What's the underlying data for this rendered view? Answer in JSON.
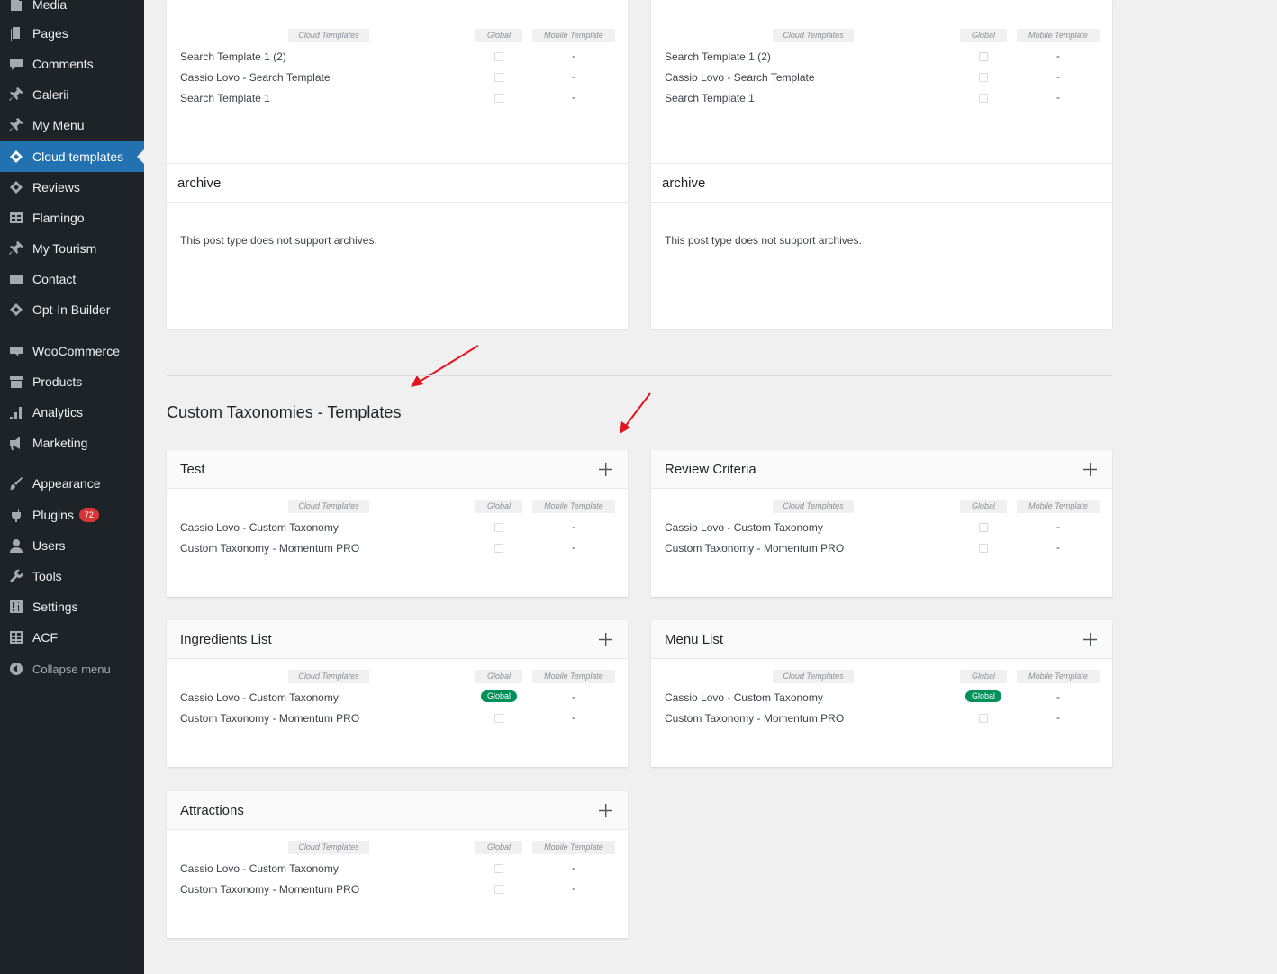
{
  "sidebar": {
    "items": [
      {
        "label": "Media",
        "icon": "media-icon"
      },
      {
        "label": "Pages",
        "icon": "pages-icon"
      },
      {
        "label": "Comments",
        "icon": "comments-icon"
      },
      {
        "label": "Galerii",
        "icon": "pin-icon"
      },
      {
        "label": "My Menu",
        "icon": "pin-icon"
      },
      {
        "label": "Cloud templates",
        "icon": "diamond-icon",
        "current": true
      },
      {
        "label": "Reviews",
        "icon": "diamond-icon"
      },
      {
        "label": "Flamingo",
        "icon": "table-icon"
      },
      {
        "label": "My Tourism",
        "icon": "pin-icon"
      },
      {
        "label": "Contact",
        "icon": "mail-icon"
      },
      {
        "label": "Opt-In Builder",
        "icon": "diamond-icon"
      },
      {
        "label": "WooCommerce",
        "icon": "woo-icon"
      },
      {
        "label": "Products",
        "icon": "archive-icon"
      },
      {
        "label": "Analytics",
        "icon": "bar-chart-icon"
      },
      {
        "label": "Marketing",
        "icon": "megaphone-icon"
      },
      {
        "label": "Appearance",
        "icon": "brush-icon"
      },
      {
        "label": "Plugins",
        "icon": "plug-icon",
        "badge": "72"
      },
      {
        "label": "Users",
        "icon": "user-icon"
      },
      {
        "label": "Tools",
        "icon": "wrench-icon"
      },
      {
        "label": "Settings",
        "icon": "sliders-icon"
      },
      {
        "label": "ACF",
        "icon": "grid-icon"
      }
    ],
    "collapse_label": "Collapse menu"
  },
  "labels": {
    "cloud_templates": "Cloud Templates",
    "global": "Global",
    "mobile_template": "Mobile Template",
    "dash": "-",
    "global_badge": "Global"
  },
  "top_cards": [
    {
      "rows": [
        "Search Template 1 (2)",
        "Cassio Lovo - Search Template",
        "Search Template 1"
      ],
      "archive_title": "archive",
      "archive_text": "This post type does not support archives."
    },
    {
      "rows": [
        "Search Template 1 (2)",
        "Cassio Lovo - Search Template",
        "Search Template 1"
      ],
      "archive_title": "archive",
      "archive_text": "This post type does not support archives."
    }
  ],
  "section_title": "Custom Taxonomies - Templates",
  "taxonomy_cards": [
    {
      "title": "Test",
      "rows": [
        {
          "name": "Cassio Lovo - Custom Taxonomy",
          "global": false
        },
        {
          "name": "Custom Taxonomy - Momentum PRO",
          "global": false
        }
      ]
    },
    {
      "title": "Review Criteria",
      "rows": [
        {
          "name": "Cassio Lovo - Custom Taxonomy",
          "global": false
        },
        {
          "name": "Custom Taxonomy - Momentum PRO",
          "global": false
        }
      ]
    },
    {
      "title": "Ingredients List",
      "rows": [
        {
          "name": "Cassio Lovo - Custom Taxonomy",
          "global": true
        },
        {
          "name": "Custom Taxonomy - Momentum PRO",
          "global": false
        }
      ]
    },
    {
      "title": "Menu List",
      "rows": [
        {
          "name": "Cassio Lovo - Custom Taxonomy",
          "global": true
        },
        {
          "name": "Custom Taxonomy - Momentum PRO",
          "global": false
        }
      ]
    },
    {
      "title": "Attractions",
      "rows": [
        {
          "name": "Cassio Lovo - Custom Taxonomy",
          "global": false
        },
        {
          "name": "Custom Taxonomy - Momentum PRO",
          "global": false
        }
      ]
    }
  ],
  "colors": {
    "sidebar_bg": "#1d2327",
    "current_bg": "#2271b1",
    "global_badge": "#00915a",
    "plugins_badge": "#d63638",
    "arrow": "#e0141e"
  }
}
